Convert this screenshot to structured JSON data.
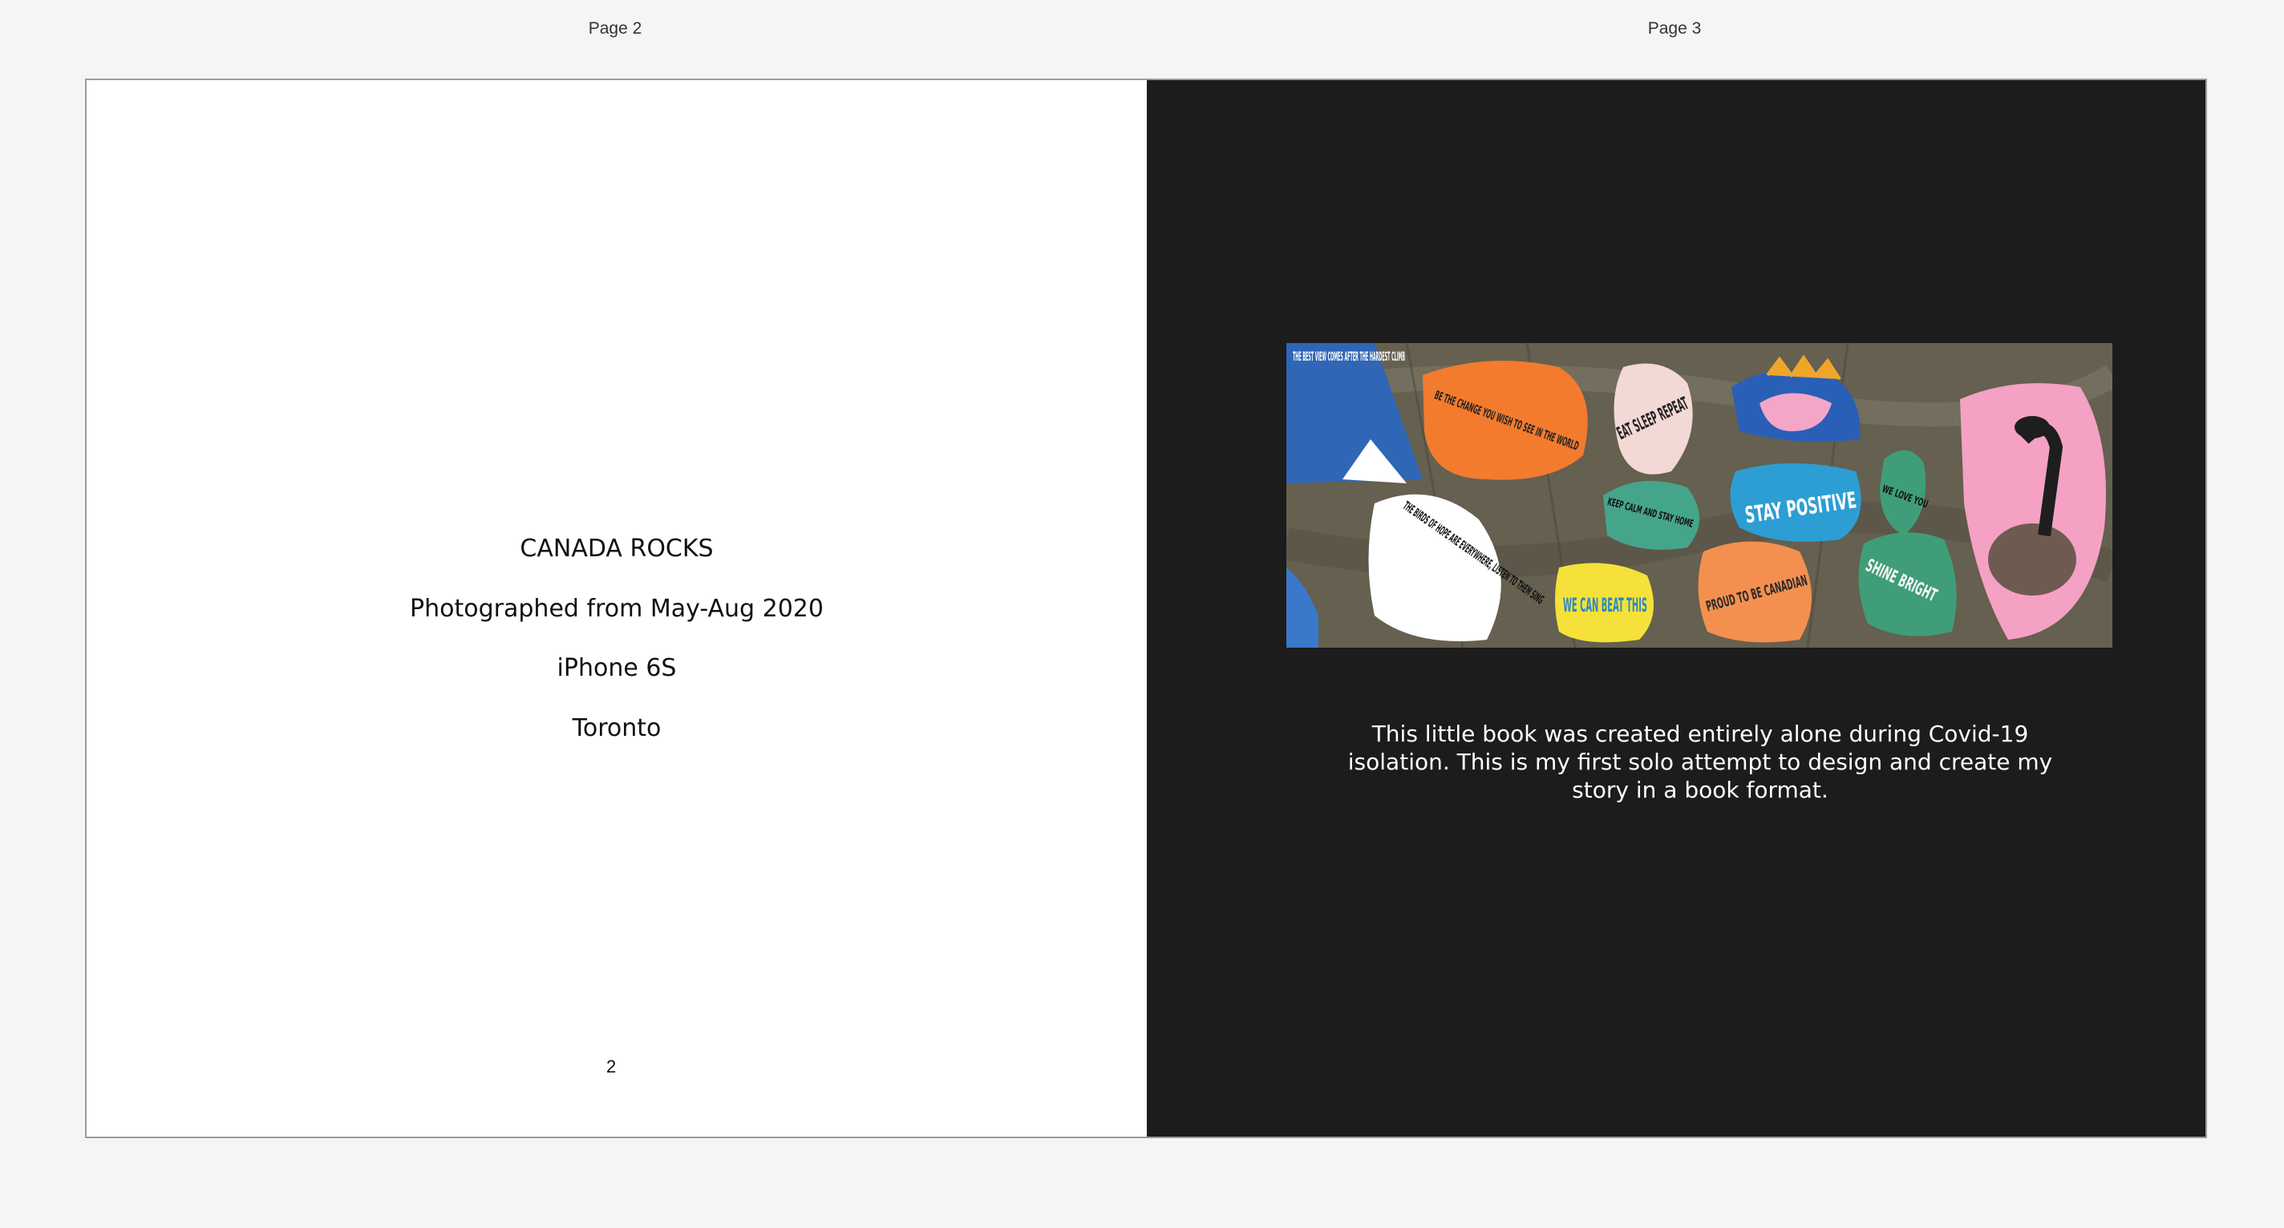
{
  "labels": {
    "left": "Page 2",
    "right": "Page 3"
  },
  "left_page": {
    "title": "CANADA ROCKS",
    "dates": "Photographed from May-Aug 2020",
    "device": "iPhone 6S",
    "location": "Toronto",
    "page_number": "2"
  },
  "right_page": {
    "rocks": {
      "r1": "THE BEST VIEW COMES AFTER THE HARDEST CLIMB",
      "r2": "BE THE CHANGE YOU WISH TO SEE IN THE WORLD",
      "r3": "EAT SLEEP REPEAT",
      "r4": "KEEP CALM AND STAY HOME",
      "r5": "STAY POSITIVE",
      "r6": "WE LOVE YOU",
      "r7": "THE BIRDS OF HOPE ARE EVERYWHERE, LISTEN TO THEM SING",
      "r8": "WE CAN BEAT THIS",
      "r9": "PROUD TO BE CANADIAN",
      "r10": "SHINE BRIGHT"
    },
    "caption": "This little book was created entirely alone during Covid-19 isolation. This is my first solo attempt to design and create my story in a book format."
  }
}
